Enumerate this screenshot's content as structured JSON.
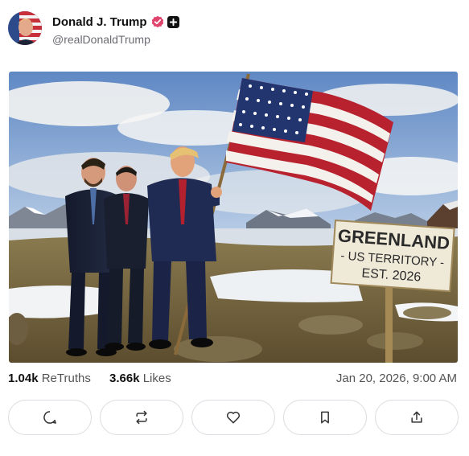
{
  "author": {
    "display_name": "Donald J. Trump",
    "handle": "@realDonaldTrump",
    "verified": true,
    "accent_color": "#e0436b"
  },
  "media": {
    "sign_line1": "GREENLAND",
    "sign_line2": "- US TERRITORY -",
    "sign_line3": "EST. 2026"
  },
  "stats": {
    "retruths_count": "1.04k",
    "retruths_label": "ReTruths",
    "likes_count": "3.66k",
    "likes_label": "Likes",
    "timestamp": "Jan 20, 2026, 9:00 AM"
  },
  "actions": [
    {
      "icon": "reply-icon"
    },
    {
      "icon": "retruth-icon"
    },
    {
      "icon": "like-icon"
    },
    {
      "icon": "bookmark-icon"
    },
    {
      "icon": "share-icon"
    }
  ]
}
